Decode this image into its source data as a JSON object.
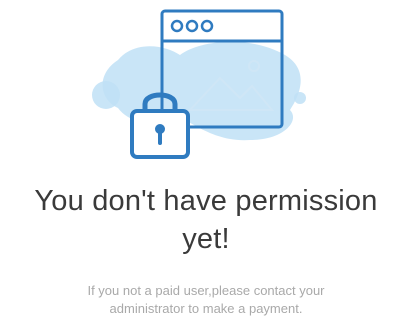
{
  "illustration": {
    "icon": "locked-browser-window-icon",
    "colors": {
      "outline": "#2f7bc0",
      "splash": "#bfe0f6",
      "lock_body": "#ffffff"
    }
  },
  "heading": {
    "line1": "You don't have permission",
    "line2": "yet!"
  },
  "message": {
    "line1": "If you not a paid user,please contact your",
    "line2": "administrator to make a payment."
  }
}
